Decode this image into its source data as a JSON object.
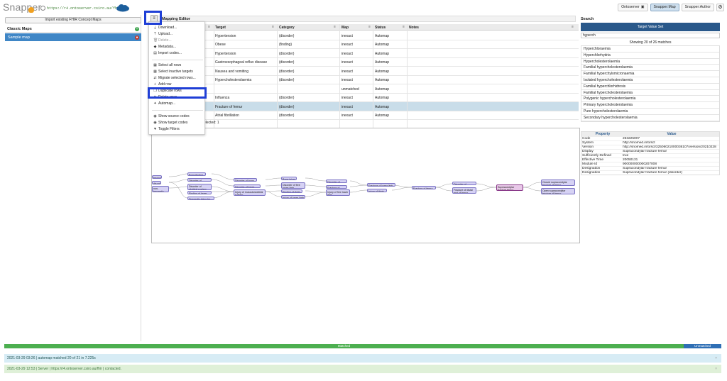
{
  "header": {
    "logo": "Snapper",
    "url": "https://r4.ontoserver.csiro.au/fhir",
    "buttons": [
      "Ontoserver",
      "Snapper:Map",
      "Snapper:Author"
    ],
    "active_button": "Snapper:Map"
  },
  "left": {
    "import_button": "Import existing FHIR Concept Maps",
    "section_title": "Classic Maps",
    "maps": [
      "Sample map"
    ]
  },
  "editor": {
    "title": "Mapping Editor",
    "columns": [
      "Target",
      "Category",
      "Map",
      "Status",
      "Notes"
    ],
    "rows": [
      {
        "target": "Hypertension",
        "category": "(disorder)",
        "map": "inexact",
        "status": "Automap"
      },
      {
        "target": "Obese",
        "category": "(finding)",
        "map": "inexact",
        "status": "Automap"
      },
      {
        "target": "Hypertension",
        "category": "(disorder)",
        "map": "inexact",
        "status": "Automap"
      },
      {
        "target": "Gastroesophageal reflux disease",
        "category": "(disorder)",
        "map": "inexact",
        "status": "Automap"
      },
      {
        "target": "Nausea and vomiting",
        "category": "(disorder)",
        "map": "inexact",
        "status": "Automap"
      },
      {
        "target": "Hypercholesterolaemia",
        "category": "(disorder)",
        "map": "inexact",
        "status": "Automap"
      },
      {
        "target": "",
        "category": "",
        "map": "unmatched",
        "status": "Automap"
      },
      {
        "target": "Influenza",
        "category": "(disorder)",
        "map": "inexact",
        "status": "Automap"
      },
      {
        "target": "Fracture of femur",
        "category": "(disorder)",
        "map": "inexact",
        "status": "Automap"
      },
      {
        "target": "Atrial fibrillation",
        "category": "(disorder)",
        "map": "inexact",
        "status": "Automap"
      }
    ],
    "selected_row": 8,
    "selected_text": "elected: 1"
  },
  "menu": {
    "items": [
      {
        "label": "Download...",
        "icon": "download-icon",
        "disabled": false
      },
      {
        "label": "Upload...",
        "icon": "upload-icon",
        "disabled": false
      },
      {
        "label": "Delete...",
        "icon": "trash-icon",
        "disabled": true
      },
      {
        "label": "Metadata...",
        "icon": "tag-icon",
        "disabled": false
      },
      {
        "label": "Import codes...",
        "icon": "import-icon",
        "disabled": false
      },
      {
        "label": "Select all rows",
        "icon": "select-all-icon",
        "disabled": false
      },
      {
        "label": "Select inactive targets",
        "icon": "select-icon",
        "disabled": false
      },
      {
        "label": "Migrate selected rows...",
        "icon": "migrate-icon",
        "disabled": false
      },
      {
        "label": "Add row",
        "icon": "add-icon",
        "disabled": false
      },
      {
        "label": "Duplicate rows",
        "icon": "copy-icon",
        "disabled": false
      },
      {
        "label": "Delete rows",
        "icon": "delete-rows-icon",
        "disabled": false
      },
      {
        "label": "Automap...",
        "icon": "automap-icon",
        "disabled": false
      },
      {
        "label": "Show source codes",
        "icon": "eye-icon",
        "disabled": false
      },
      {
        "label": "Show target codes",
        "icon": "eye-icon",
        "disabled": false
      },
      {
        "label": "Toggle Filters",
        "icon": "filter-icon",
        "disabled": false
      }
    ]
  },
  "graph": {
    "nodes": [
      {
        "id": "n1",
        "label": "fracture"
      },
      {
        "id": "n2",
        "label": "disorder"
      },
      {
        "id": "n3",
        "label": "non-traumatic order"
      },
      {
        "id": "n4",
        "label": "Bone finding"
      },
      {
        "id": "n5",
        "label": "Disorder of extremity"
      },
      {
        "id": "n6",
        "label": "Disorder of skeletal system"
      },
      {
        "id": "n7",
        "label": "Finding of lower limb"
      },
      {
        "id": "n8",
        "label": "Traumatic injury by site"
      },
      {
        "id": "n9",
        "label": "Disorder of bone"
      },
      {
        "id": "n10",
        "label": "Disorder of lower limb"
      },
      {
        "id": "n11",
        "label": "Injury of musculoskeletal system"
      },
      {
        "id": "n12",
        "label": "Bone injury"
      },
      {
        "id": "n13",
        "label": "Disorder of free lower limb"
      },
      {
        "id": "n14",
        "label": "Finding of thigh"
      },
      {
        "id": "n15",
        "label": "Injury of lower limb"
      },
      {
        "id": "n16",
        "label": "Disorder of thigh"
      },
      {
        "id": "n17",
        "label": "Fracture of bone"
      },
      {
        "id": "n18",
        "label": "Injury of free lower limb"
      },
      {
        "id": "n19",
        "label": "Fracture of lower limb"
      },
      {
        "id": "n20",
        "label": "Injury of thigh"
      },
      {
        "id": "n21",
        "label": "Fracture of femur"
      },
      {
        "id": "n22",
        "label": "Disorder of diaphysis"
      },
      {
        "id": "n23",
        "label": "Fracture of distal end of femur"
      },
      {
        "id": "n24",
        "label": "Supracondylar fracture femur"
      },
      {
        "id": "n25",
        "label": "Closed supracondylar fracture of femur"
      },
      {
        "id": "n26",
        "label": "Open supracondylar fracture of femur"
      }
    ]
  },
  "search": {
    "title": "Search",
    "button": "Target Value Set",
    "query": "hyperch",
    "showing": "Showing 20 of 26 matches",
    "results": [
      "Hyperchloraemia",
      "Hyperchlorhydria",
      "Hypercholesterolaemia",
      "Familial hypercholesterolaemia",
      "Familial hyperchylomicronaemia",
      "Isolated hypercholesterolaemia",
      "Familial hyperchlorhidrosis",
      "Familial hypercholesterolaemia",
      "Polygenic hypercholesterolaemia",
      "Primary hypercholesterolaemia",
      "Pure hypercholesterolaemia",
      "Secondary hypercholesterolaemia"
    ],
    "property_header": "Property",
    "value_header": "Value",
    "properties": [
      {
        "k": "Code",
        "v": "263225007"
      },
      {
        "k": "System",
        "v": "http://snomed.info/sct"
      },
      {
        "k": "Version",
        "v": "http://snomed.info/sct/32506021000036107/version/20210228"
      },
      {
        "k": "Display",
        "v": "Supracondylar fracture femur"
      },
      {
        "k": "Sufficiently Defined",
        "v": "true"
      },
      {
        "k": "Effective Time",
        "v": "20050131"
      },
      {
        "k": "Module Id",
        "v": "900000000000207008"
      },
      {
        "k": "Designation",
        "v": "Supracondylar fracture femur"
      },
      {
        "k": "Designation",
        "v": "Supracondylar fracture femur (disorder)"
      }
    ]
  },
  "footer": {
    "matched": "Matched",
    "unmatched": "Unmatched",
    "log1": "2021-03-29 03:26 | automap matched 20 of 21 in 7.225s",
    "log2": "2021-03-29 12:53 | Server | https://r4.ontoserver.csiro.au/fhir | contacted."
  }
}
